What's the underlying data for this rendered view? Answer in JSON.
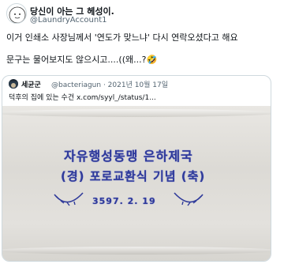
{
  "tweet": {
    "author_name": "당신이 아는 그 헤성이.",
    "author_handle": "@LaundryAccount1",
    "line1": "이거 인쇄소 사장님께서 '연도가 맞느냐' 다시 연락오셨다고 해요",
    "line2": "문구는 물어보지도 않으시고....((왜...?🤣"
  },
  "quote": {
    "author_name": "세균군",
    "meta": "@bacteriagun · 2021년 10월 17일",
    "text": "덕후의 집에 있는 수건  x.com/syyl_/status/1...",
    "towel": {
      "line1": "자유행성동맹 은하제국",
      "line2": "(경) 포로교환식 기념 (축)",
      "line3": "3597. 2. 19"
    }
  },
  "colors": {
    "embroidery": "#2f3a9a",
    "muted": "#536471",
    "border": "#cfd9de"
  }
}
